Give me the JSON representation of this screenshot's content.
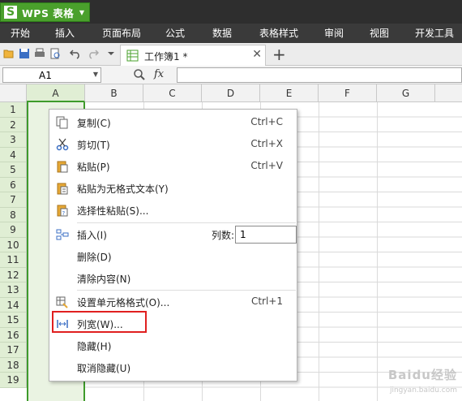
{
  "app": {
    "logo_letter": "S",
    "title": "WPS 表格"
  },
  "menu_tabs": [
    "开始",
    "插入",
    "页面布局",
    "公式",
    "数据",
    "表格样式",
    "审阅",
    "视图",
    "开发工具"
  ],
  "doc_tab": {
    "label": "工作簿1 *"
  },
  "namebox": {
    "value": "A1"
  },
  "formula": {
    "fx_label": "fx",
    "value": ""
  },
  "columns": [
    "A",
    "B",
    "C",
    "D",
    "E",
    "F",
    "G"
  ],
  "rows": [
    "1",
    "2",
    "3",
    "4",
    "5",
    "6",
    "7",
    "8",
    "9",
    "10",
    "11",
    "12",
    "13",
    "14",
    "15",
    "16",
    "17",
    "18",
    "19"
  ],
  "context_menu": {
    "copy": {
      "label": "复制(C)",
      "shortcut": "Ctrl+C"
    },
    "cut": {
      "label": "剪切(T)",
      "shortcut": "Ctrl+X"
    },
    "paste": {
      "label": "粘贴(P)",
      "shortcut": "Ctrl+V"
    },
    "paste_plain": {
      "label": "粘贴为无格式文本(Y)"
    },
    "paste_special": {
      "label": "选择性粘贴(S)..."
    },
    "insert": {
      "label": "插入(I)",
      "count_label": "列数:",
      "count_value": "1"
    },
    "delete": {
      "label": "删除(D)"
    },
    "clear": {
      "label": "清除内容(N)"
    },
    "format_cells": {
      "label": "设置单元格格式(O)...",
      "shortcut": "Ctrl+1"
    },
    "col_width": {
      "label": "列宽(W)..."
    },
    "hide": {
      "label": "隐藏(H)"
    },
    "unhide": {
      "label": "取消隐藏(U)"
    }
  },
  "watermark": {
    "text": "Baidu经验",
    "url": "jingyan.baidu.com"
  },
  "colors": {
    "accent": "#4aa02c",
    "highlight": "#e02020"
  }
}
